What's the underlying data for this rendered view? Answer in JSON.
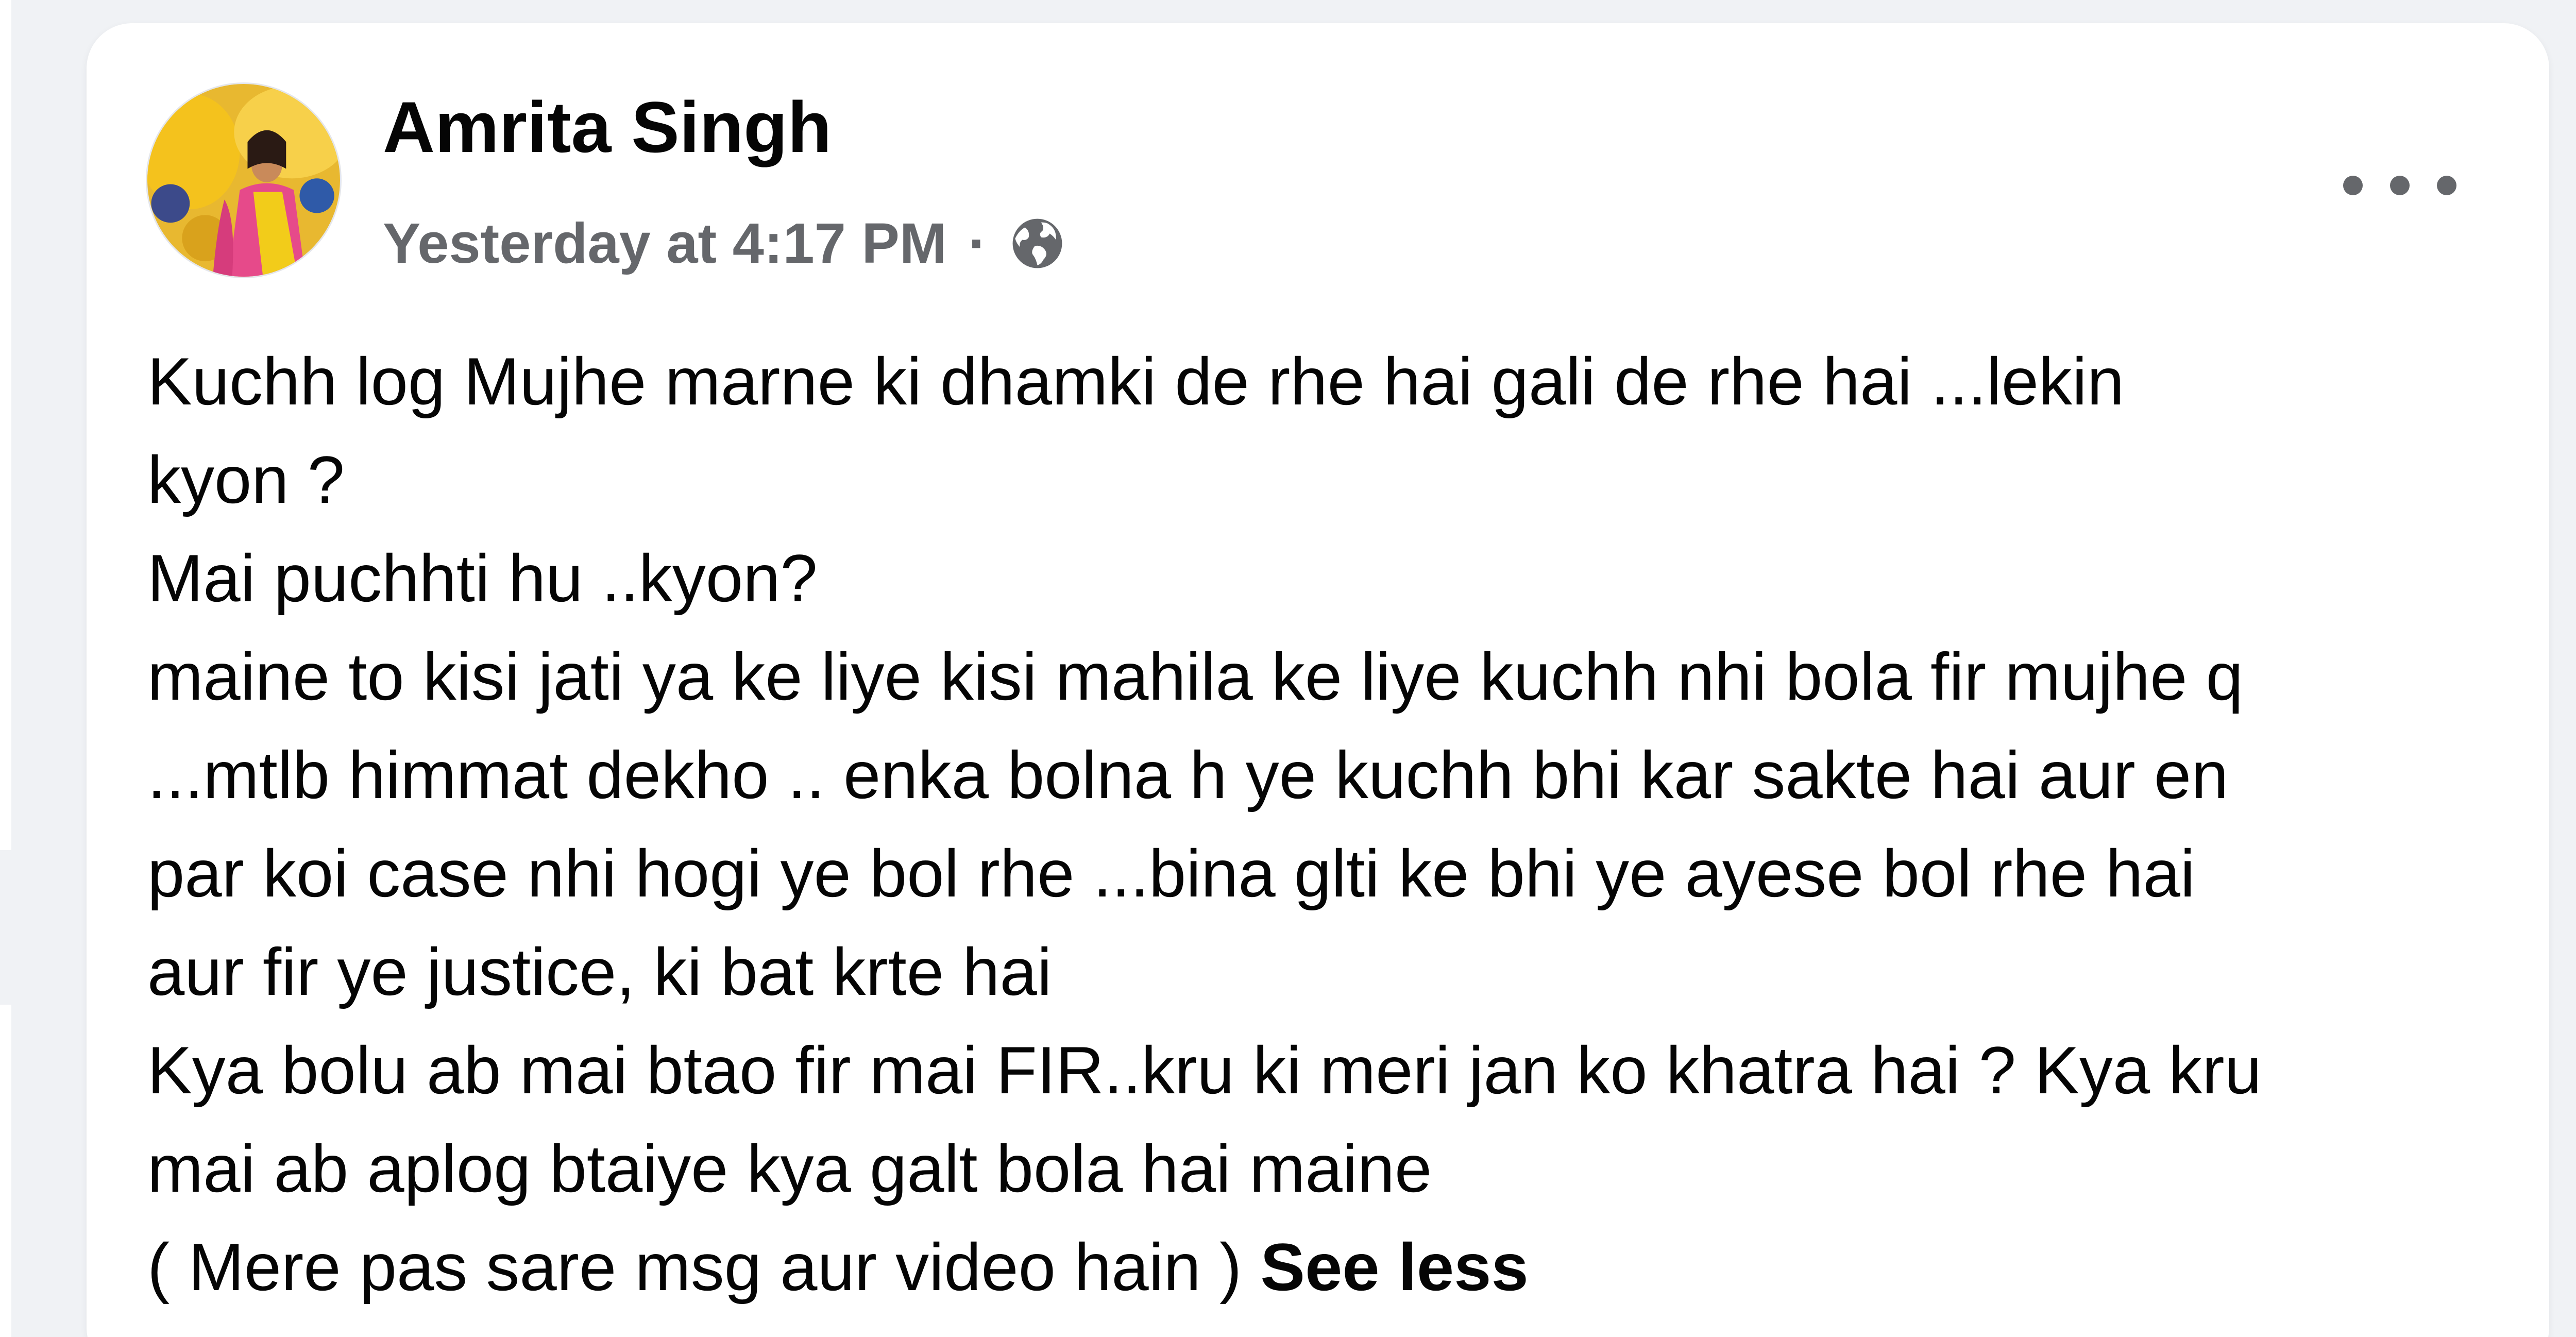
{
  "post": {
    "author": "Amrita Singh",
    "timestamp": "Yesterday at 4:17 PM",
    "separator": "·",
    "audience_icon": "globe-icon",
    "more_icon": "more-options-icon",
    "lines": [
      "Kuchh log Mujhe marne ki dhamki de rhe hai gali de rhe hai ...lekin",
      "kyon ?",
      "Mai puchhti hu ..kyon?",
      "maine to kisi jati ya ke liye kisi mahila ke liye kuchh nhi bola fir mujhe q",
      "...mtlb himmat dekho .. enka bolna h ye kuchh bhi kar sakte hai aur en",
      "par koi  case nhi hogi ye bol rhe ...bina glti ke bhi ye ayese bol rhe hai",
      "aur fir ye justice, ki bat krte hai",
      "Kya bolu ab mai btao fir mai FIR..kru ki meri jan ko khatra hai ? Kya kru",
      "mai ab aplog btaiye kya galt bola hai maine",
      "( Mere pas sare msg aur video hain ) "
    ],
    "see_less_label": "See less"
  },
  "colors": {
    "page_background": "#f0f2f5",
    "card_background": "#ffffff",
    "primary_text": "#050505",
    "secondary_text": "#65676b"
  }
}
